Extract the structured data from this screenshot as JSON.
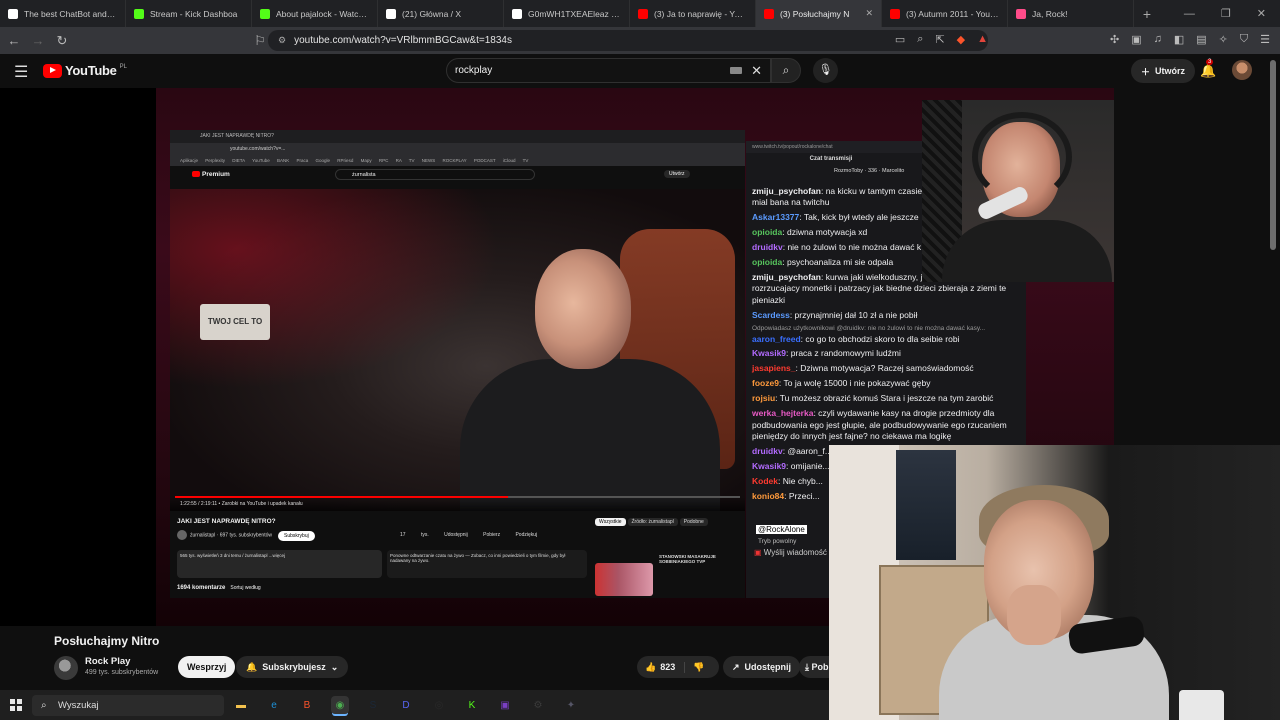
{
  "browser": {
    "tabs": [
      {
        "title": "The best ChatBot and Wi",
        "icon": "chatbot-icon",
        "color": "#ffffff",
        "active": false
      },
      {
        "title": "Stream - Kick Dashboa",
        "icon": "kick-icon",
        "color": "#53fc18",
        "active": false
      },
      {
        "title": "About pajalock - Watch Li",
        "icon": "kick-icon",
        "color": "#53fc18",
        "active": false
      },
      {
        "title": "(21) Główna / X",
        "icon": "x-icon",
        "color": "#ffffff",
        "active": false
      },
      {
        "title": "G0mWH1TXEAEleaz (593×",
        "icon": "x-icon",
        "color": "#ffffff",
        "active": false
      },
      {
        "title": "(3) Ja to naprawię - YouTu",
        "icon": "youtube-icon",
        "color": "#ff0000",
        "active": false
      },
      {
        "title": "(3) Posłuchajmy N",
        "icon": "youtube-icon",
        "color": "#ff0000",
        "active": true
      },
      {
        "title": "(3) Autumn 2011 - YouTu",
        "icon": "youtube-icon",
        "color": "#ff0000",
        "active": false
      },
      {
        "title": "Ja, Rock!",
        "icon": "music-icon",
        "color": "#ff4c8a",
        "active": false
      }
    ],
    "url": "youtube.com/watch?v=VRlbmmBGCaw&t=1834s"
  },
  "youtube": {
    "logo_text": "YouTube",
    "region": "PL",
    "search_value": "rockplay",
    "create_label": "Utwórz",
    "notif_count": "3",
    "accent": "#ff0000"
  },
  "inner_screen": {
    "tab_text": "JAKI JEST NAPRAWDĘ NITRO?",
    "url": "youtube.com/watch?v=...",
    "bookmarks": "Aplikacje  Perplexity  DIETA  YouTube  BANK  Praca  Google  RPriesd  Mapy RPC  RA  TV  NEWS  ROCKPLAY  PODCAST  iCloud  TV",
    "search_value": "żurnalista",
    "create_label": "Utwórz",
    "logo_text": "Premium",
    "shelf_sign": "TWOJ CEL TO",
    "time": "1:22:55 / 2:19:11 • Zarobki na YouTube i upadek kanału",
    "title": "JAKI JEST NAPRAWDĘ NITRO?",
    "channel": "żurnalistapl",
    "channel_subs": "697 tys. subskrybentów",
    "support": "Wesprzyj",
    "subscribe": "Subskrybuj",
    "actions": "17 tys.  Udostępnij  Pobierz  Podziękuj",
    "desc": "565 tys. wyświetleń  3 dni temu / żurnalistapl ...więcej",
    "replay": "Ponowne odtwarzanie czatu na żywo — Zobacz, co inni powiedzieli o tym filmie, gdy był nadawany na żywo.",
    "replay_btn": "Otwórz panel",
    "chips": [
      "Wszystkie",
      "Źródło: żurnalistapl",
      "Podobne"
    ],
    "rec_title": "STANOWSKI MASAKRUJE SOBIENIAKIEGO TVP",
    "comments": "1694 komentarze",
    "sort": "Sortuj według",
    "taskbar_search": "Wyszukaj"
  },
  "chat": {
    "url": "www.twitch.tv/popout/rockalone/chat",
    "header": "Czat transmisji",
    "pinned_user": "RozmoToby",
    "pinned_count": "336",
    "pinned_user2": "Marcelito",
    "messages": [
      {
        "user": "zmiju_psychofan",
        "color": "#efeff1",
        "text": "na kicku w tamtym czasie on i Szymol, ktory tez mial bana na twitchu"
      },
      {
        "user": "Askar13377",
        "color": "#5b9bff",
        "text": "Tak, kick był wtedy ale jeszcze"
      },
      {
        "user": "opioida",
        "color": "#57c45d",
        "text": "dziwna motywacja xd"
      },
      {
        "user": "druidkv",
        "color": "#b36bff",
        "text": "nie no żulowi to nie można dawać k"
      },
      {
        "user": "opioida",
        "color": "#57c45d",
        "text": "psychoanaliza mi sie odpala"
      },
      {
        "user": "zmiju_psychofan",
        "color": "#efeff1",
        "text": "kurwa jaki wielkoduszny, jak kolonialista rozrzucajacy monetki i patrzacy jak biedne dzieci zbieraja z ziemi te pieniazki"
      },
      {
        "user": "Scardess",
        "color": "#5b9bff",
        "text": "przynajmniej dał 10 zł a nie pobił"
      },
      {
        "user": "aaron_freed",
        "color": "#3a6fff",
        "text": "co go to obchodzi skoro to dla seibie robi"
      },
      {
        "user": "Kwasik9",
        "color": "#b36bff",
        "text": "praca z randomowymi ludźmi"
      },
      {
        "user": "jasapiens_",
        "color": "#ff3b30",
        "text": "Dziwna motywacja? Raczej samoświadomość"
      },
      {
        "user": "fooze9",
        "color": "#ff9a3c",
        "text": "To ja wolę 15000 i nie pokazywać gęby"
      },
      {
        "user": "rojsiu",
        "color": "#ff9a3c",
        "text": "Tu możesz obrazić komuś Stara i jeszcze na tym zarobić"
      },
      {
        "user": "werka_hejterka",
        "color": "#e85ac5",
        "text": "czyli wydawanie kasy na drogie przedmioty dla podbudowania ego jest głupie, ale podbudowywanie ego rzucaniem pieniędzy do innych jest fajne? no ciekawa ma logikę"
      },
      {
        "user": "druidkv",
        "color": "#b36bff",
        "text": "@aaron_f... ze sobą to faktycznie... wystarczy że o nim r..."
      },
      {
        "user": "Kwasik9",
        "color": "#b36bff",
        "text": "omijanie..."
      },
      {
        "user": "Kodek",
        "color": "#ff3b30",
        "text": "Nie chyb..."
      },
      {
        "user": "konio84",
        "color": "#ff9a3c",
        "text": "Przeci..."
      }
    ],
    "reply_note": "Odpowiadasz użytkownikowi @druidkv: nie no żulowi to nie można dawać kasy...",
    "mention": "@RockAlone",
    "slow_mode": "Tryb powolny",
    "input_placeholder": "Wyślij wiadomość"
  },
  "video": {
    "title": "Posłuchajmy Nitro",
    "channel_name": "Rock Play",
    "channel_subs": "499 tys. subskrybentów",
    "support_label": "Wesprzyj",
    "subscribed_label": "Subskrybujesz",
    "likes": "823",
    "share_label": "Udostępnij",
    "download_label": "Pobierz"
  },
  "taskbar": {
    "search_label": "Wyszukaj",
    "apps": [
      {
        "icon": "file-explorer-icon",
        "glyph": "▬",
        "color": "#f2c14e"
      },
      {
        "icon": "edge-icon",
        "glyph": "e",
        "color": "#1e90d6"
      },
      {
        "icon": "brave-icon",
        "glyph": "B",
        "color": "#fb542b"
      },
      {
        "icon": "chrome-icon",
        "glyph": "◉",
        "color": "#4caf50"
      },
      {
        "icon": "steam-icon",
        "glyph": "S",
        "color": "#1b2838"
      },
      {
        "icon": "discord-icon",
        "glyph": "D",
        "color": "#5865f2"
      },
      {
        "icon": "obs-icon",
        "glyph": "◎",
        "color": "#2a2a2a"
      },
      {
        "icon": "kick-icon",
        "glyph": "K",
        "color": "#53fc18"
      },
      {
        "icon": "media-icon",
        "glyph": "▣",
        "color": "#7a3fc4"
      },
      {
        "icon": "settings-icon",
        "glyph": "⚙",
        "color": "#3a3a3a"
      },
      {
        "icon": "app-icon",
        "glyph": "✦",
        "color": "#556"
      }
    ]
  }
}
